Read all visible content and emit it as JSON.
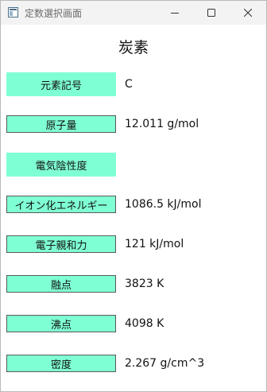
{
  "window": {
    "title": "定数選択画面"
  },
  "element": {
    "name": "炭素"
  },
  "properties": [
    {
      "label": "元素記号",
      "value": "C"
    },
    {
      "label": "原子量",
      "value": "12.011 g/mol"
    },
    {
      "label": "電気陰性度",
      "value": ""
    },
    {
      "label": "イオン化エネルギー",
      "value": "1086.5 kJ/mol"
    },
    {
      "label": "電子親和力",
      "value": "121 kJ/mol"
    },
    {
      "label": "融点",
      "value": "3823 K"
    },
    {
      "label": "沸点",
      "value": "4098 K"
    },
    {
      "label": "密度",
      "value": "2.267 g/cm^3"
    }
  ],
  "colors": {
    "label_bg": "#7fffd4"
  },
  "icons": {
    "app": "app-window-icon",
    "minimize": "minimize-icon",
    "maximize": "maximize-icon",
    "close": "close-icon"
  }
}
